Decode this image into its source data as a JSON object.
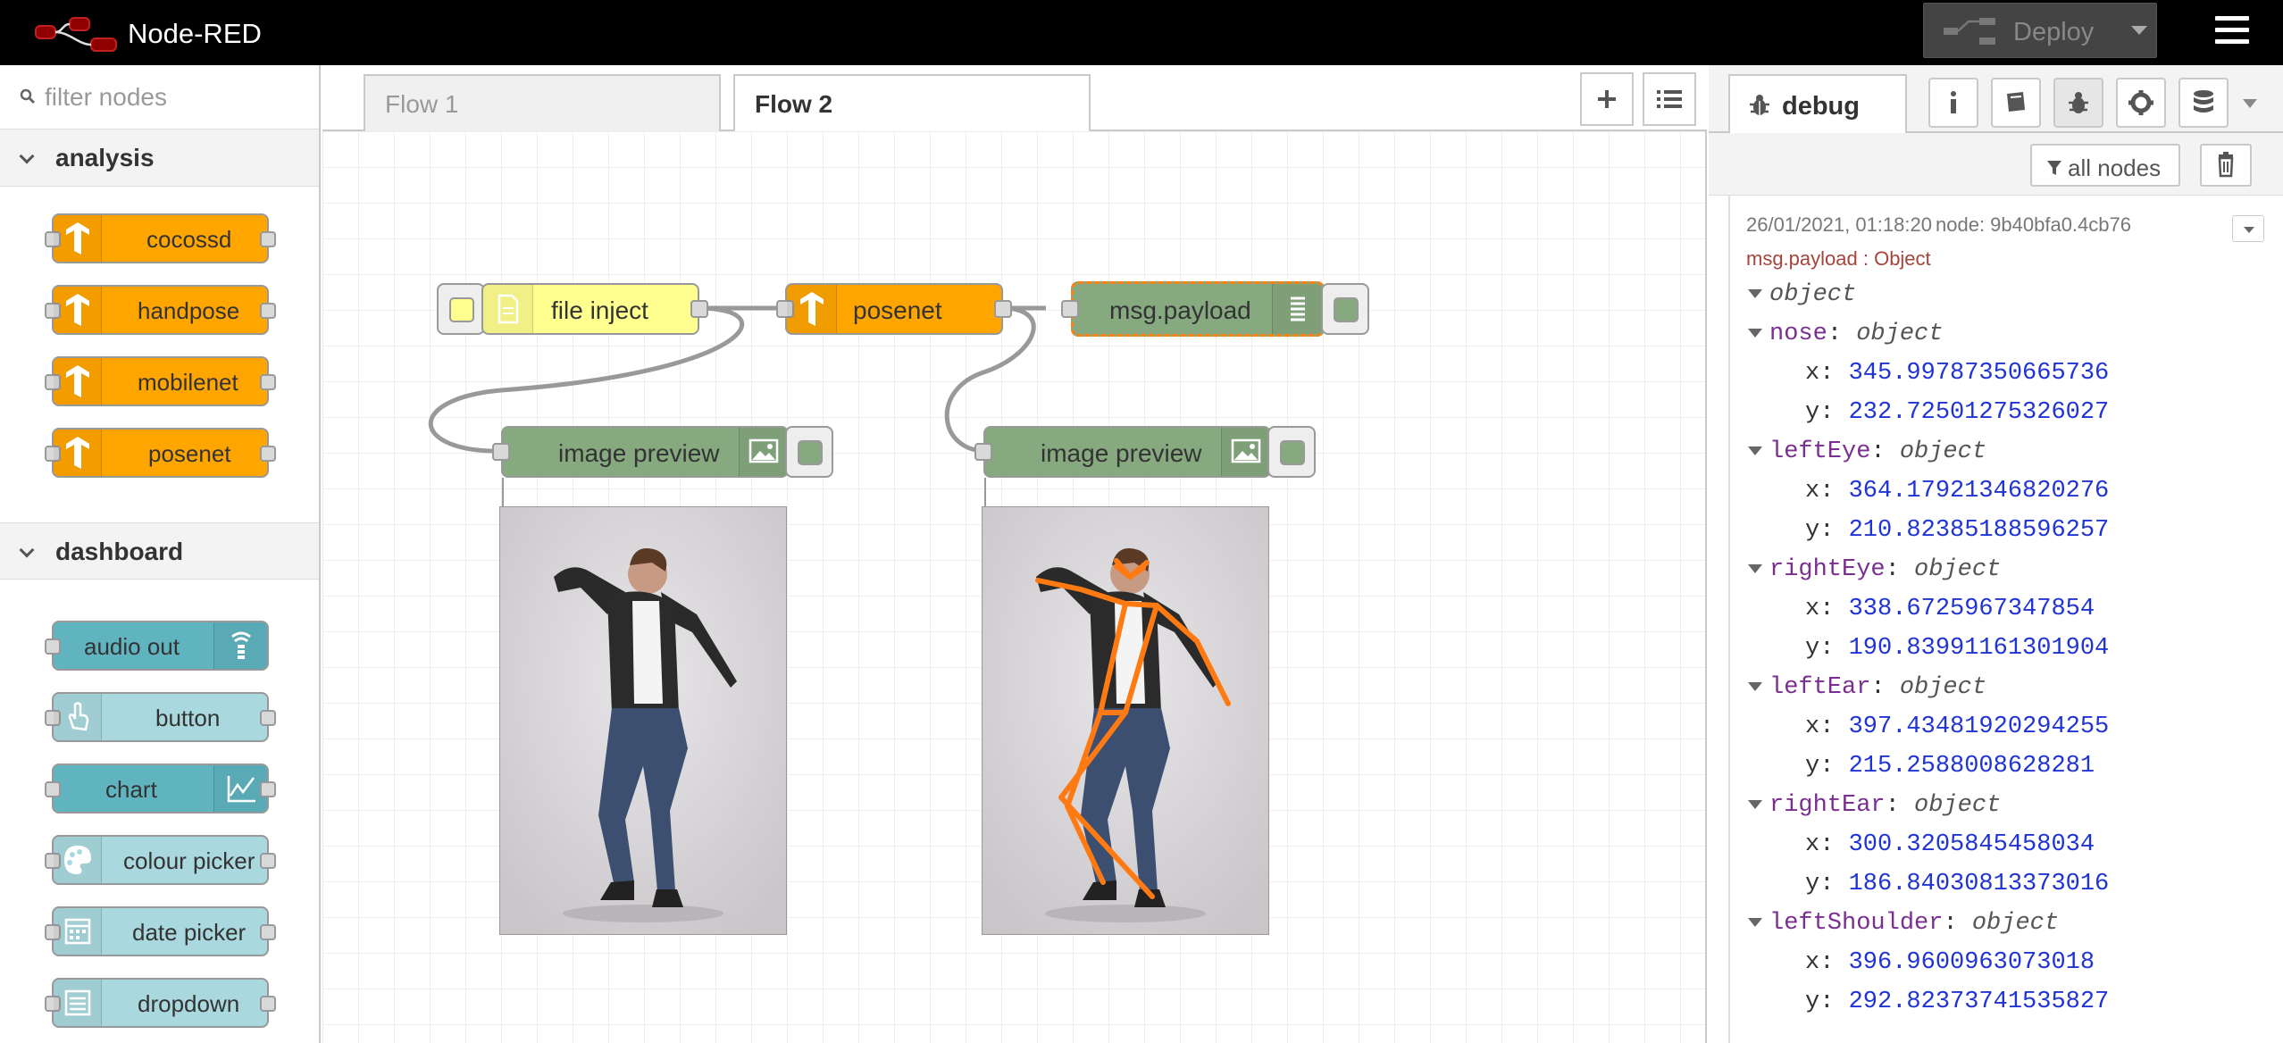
{
  "header": {
    "title": "Node-RED",
    "deploy_label": "Deploy"
  },
  "palette": {
    "search_placeholder": "filter nodes",
    "categories": [
      {
        "label": "analysis",
        "nodes": [
          "cocossd",
          "handpose",
          "mobilenet",
          "posenet"
        ]
      },
      {
        "label": "dashboard",
        "nodes": [
          "audio out",
          "button",
          "chart",
          "colour picker",
          "date picker",
          "dropdown"
        ]
      }
    ]
  },
  "workspace": {
    "tabs": [
      "Flow 1",
      "Flow 2"
    ],
    "active_tab": "Flow 2",
    "nodes": {
      "file_inject": "file inject",
      "posenet": "posenet",
      "debug": "msg.payload",
      "preview1": "image preview",
      "preview2": "image preview"
    }
  },
  "sidebar": {
    "debug_tab_label": "debug",
    "filter_label": "all nodes",
    "message": {
      "timestamp": "26/01/2021, 01:18:20",
      "node": "node: 9b40bfa0.4cb76",
      "topic": "msg.payload : Object",
      "root_type": "object",
      "entries": [
        {
          "key": "nose",
          "type": "object",
          "x": "345.99787350665736",
          "y": "232.72501275326027"
        },
        {
          "key": "leftEye",
          "type": "object",
          "x": "364.17921346820276",
          "y": "210.82385188596257"
        },
        {
          "key": "rightEye",
          "type": "object",
          "x": "338.6725967347854",
          "y": "190.83991161301904"
        },
        {
          "key": "leftEar",
          "type": "object",
          "x": "397.43481920294255",
          "y": "215.2588008628281"
        },
        {
          "key": "rightEar",
          "type": "object",
          "x": "300.3205845458034",
          "y": "186.84030813373016"
        },
        {
          "key": "leftShoulder",
          "type": "object",
          "x": "396.9600963073018",
          "y": "292.82373741535827"
        }
      ]
    }
  },
  "colors": {
    "header_bg": "#000000",
    "tensorflow_node": "#ffa500",
    "dashboard_node": "#5fb4bf",
    "debug_node": "#87a980",
    "inject_node": "#ffff90",
    "selected_outline": "#ff7f0e",
    "pose_skeleton": "#ff7a12"
  }
}
